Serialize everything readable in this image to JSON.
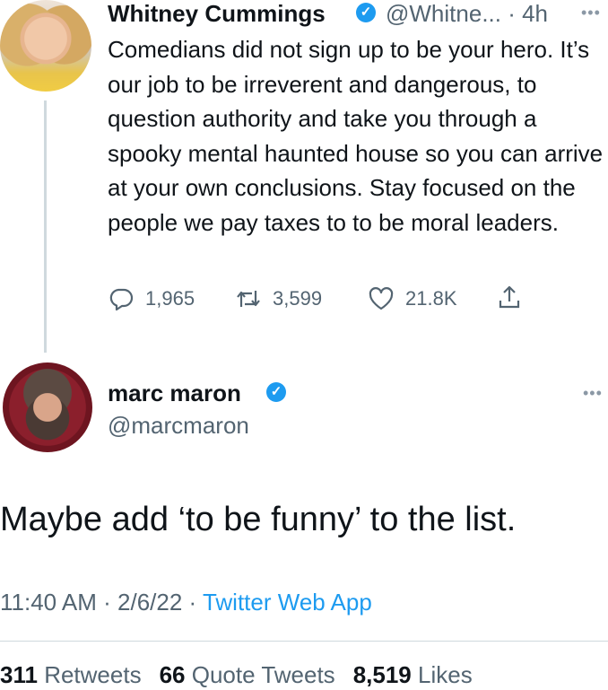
{
  "tweet1": {
    "author_name": "Whitney Cummings",
    "handle_time": "@Whitne... · 4h",
    "text": "Comedians did not sign up to be your hero. It’s our job to be irreverent and dangerous, to question authority and take you through a spooky mental haunted house so you can arrive at your own conclusions. Stay focused on the people we pay taxes to to be moral leaders.",
    "replies": "1,965",
    "retweets": "3,599",
    "likes": "21.8K"
  },
  "tweet2": {
    "author_name": "marc maron",
    "handle": "@marcmaron",
    "text": "Maybe add ‘to be funny’ to the list.",
    "time_date": "11:40 AM · 2/6/22 · ",
    "source": "Twitter Web App",
    "retweets_count": "311",
    "retweets_label": "Retweets",
    "quotes_count": "66",
    "quotes_label": "Quote Tweets",
    "likes_count": "8,519",
    "likes_label": "Likes"
  },
  "icons": {
    "verified": "verified-badge-icon",
    "more": "more-icon",
    "reply": "reply-icon",
    "retweet": "retweet-icon",
    "like": "heart-icon",
    "share": "share-icon"
  },
  "colors": {
    "accent": "#1d9bf0",
    "text": "#0f1419",
    "secondary": "#536471"
  }
}
